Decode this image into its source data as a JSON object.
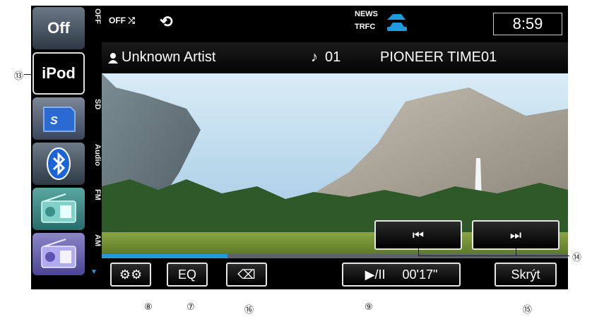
{
  "sources": [
    {
      "id": "off",
      "tile": "Off",
      "side_label": "OFF"
    },
    {
      "id": "ipod",
      "tile": "iPod",
      "side_label": ""
    },
    {
      "id": "sd",
      "tile": "",
      "side_label": "SD"
    },
    {
      "id": "bluetooth",
      "tile": "",
      "side_label": "Audio"
    },
    {
      "id": "fm",
      "tile": "",
      "side_label": "FM"
    },
    {
      "id": "am",
      "tile": "",
      "side_label": "AM"
    }
  ],
  "status": {
    "shuffle_text": "OFF",
    "news_label": "NEWS",
    "trfc_label": "TRFC",
    "time": "8:59"
  },
  "track": {
    "artist": "Unknown Artist",
    "track_no": "01",
    "title": "PIONEER TIME01"
  },
  "progress": {
    "fraction": 0.27
  },
  "controls": {
    "eq_label": "EQ",
    "play_label": "▶/II",
    "elapsed": "00'17\"",
    "hide_label": "Skrýt"
  },
  "callouts": {
    "settings": "⑧",
    "eq": "⑦",
    "back": "⑯",
    "play": "⑨",
    "hide": "⑮",
    "source": "⑬",
    "skip": "⑭"
  },
  "colors": {
    "progress_fill": "#1e9be0",
    "accent_blue": "#1e9be0"
  }
}
